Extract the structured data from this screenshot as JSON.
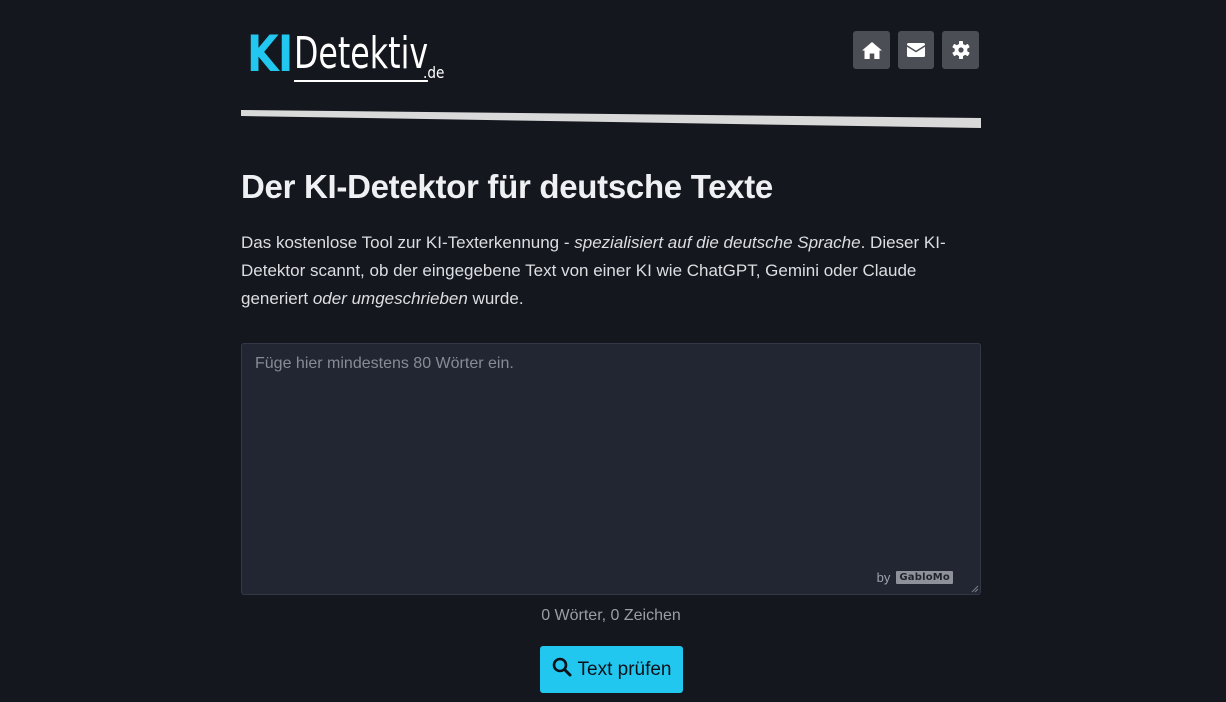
{
  "brand": {
    "logo_ki": "KI",
    "logo_name": "Detektiv",
    "logo_tld": ".de",
    "accent_color": "#22c7ef"
  },
  "nav": {
    "items": [
      {
        "icon": "home-icon"
      },
      {
        "icon": "envelope-icon"
      },
      {
        "icon": "gear-icon"
      }
    ]
  },
  "main": {
    "title": "Der KI-Detektor für deutsche Texte",
    "intro_part1": "Das kostenlose Tool zur KI-Texterkennung - ",
    "intro_em1": "spezialisiert auf die deutsche Sprache",
    "intro_part2": ". Dieser KI-Detektor scannt, ob der eingegebene Text von einer KI wie ChatGPT, Gemini oder Claude generiert ",
    "intro_em2": "oder umgeschrieben",
    "intro_part3": " wurde."
  },
  "editor": {
    "value": "",
    "placeholder": "Füge hier mindestens 80 Wörter ein.",
    "by_label": "by",
    "by_brand": "GabloMo"
  },
  "counter": "0 Wörter, 0 Zeichen",
  "submit": {
    "label": "Text prüfen",
    "icon": "search-icon"
  }
}
